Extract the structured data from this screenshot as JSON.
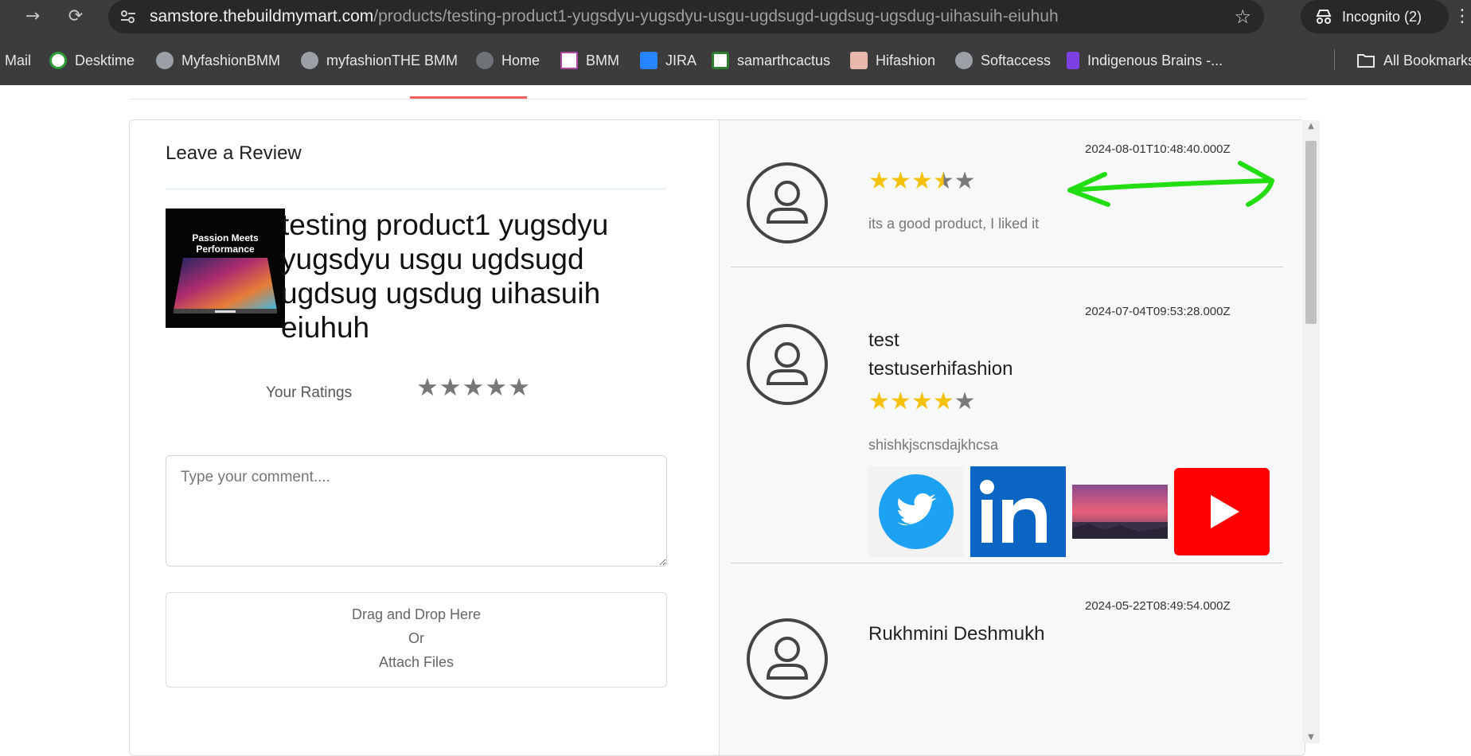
{
  "browser": {
    "url_host": "samstore.thebuildmymart.com",
    "url_path": "/products/testing-product1-yugsdyu-yugsdyu-usgu-ugdsugd-ugdsug-ugsdug-uihasuih-eiuhuh",
    "incognito_label": "Incognito (2)",
    "bookmarks": [
      {
        "label": "Mail",
        "icon": "mail-icon"
      },
      {
        "label": "Desktime",
        "icon": "desktime-icon"
      },
      {
        "label": "MyfashionBMM",
        "icon": "globe-icon"
      },
      {
        "label": "myfashionTHE BMM",
        "icon": "globe-icon"
      },
      {
        "label": "Home",
        "icon": "globe-icon"
      },
      {
        "label": "BMM",
        "icon": "bmm-icon"
      },
      {
        "label": "JIRA",
        "icon": "jira-icon"
      },
      {
        "label": "samarthcactus",
        "icon": "cactus-icon"
      },
      {
        "label": "Hifashion",
        "icon": "hifashion-icon"
      },
      {
        "label": "Softaccess",
        "icon": "globe-icon"
      },
      {
        "label": "Indigenous Brains -...",
        "icon": "indigenous-icon"
      }
    ],
    "all_bookmarks_label": "All Bookmarks"
  },
  "review_form": {
    "title": "Leave a Review",
    "product_image_text": "Passion Meets Performance",
    "product_title": "testing product1 yugsdyu yugsdyu usgu ugdsugd ugdsug ugsdug uihasuih eiuhuh",
    "ratings_label": "Your Ratings",
    "rating_value": 0,
    "rating_max": 5,
    "comment_placeholder": "Type your comment....",
    "dropzone": {
      "line1": "Drag and Drop Here",
      "line2": "Or",
      "line3": "Attach Files"
    }
  },
  "reviews": [
    {
      "date": "2024-08-01T10:48:40.000Z",
      "name": "",
      "username": "",
      "rating": 3.5,
      "text": "its a good product, I liked it",
      "media": []
    },
    {
      "date": "2024-07-04T09:53:28.000Z",
      "name": "test",
      "username": "testuserhifashion",
      "rating": 4,
      "text": "shishkjscnsdajkhcsa",
      "media": [
        "twitter-logo",
        "linkedin-logo",
        "sunset-photo",
        "youtube-logo"
      ]
    },
    {
      "date": "2024-05-22T08:49:54.000Z",
      "name": "Rukhmini Deshmukh",
      "username": "",
      "rating": null,
      "text": "",
      "media": []
    }
  ],
  "colors": {
    "accent_tab": "#f06060",
    "star_on": "#f4c20d",
    "star_off": "#7a7a7a",
    "annotation_arrow": "#22dd11"
  }
}
